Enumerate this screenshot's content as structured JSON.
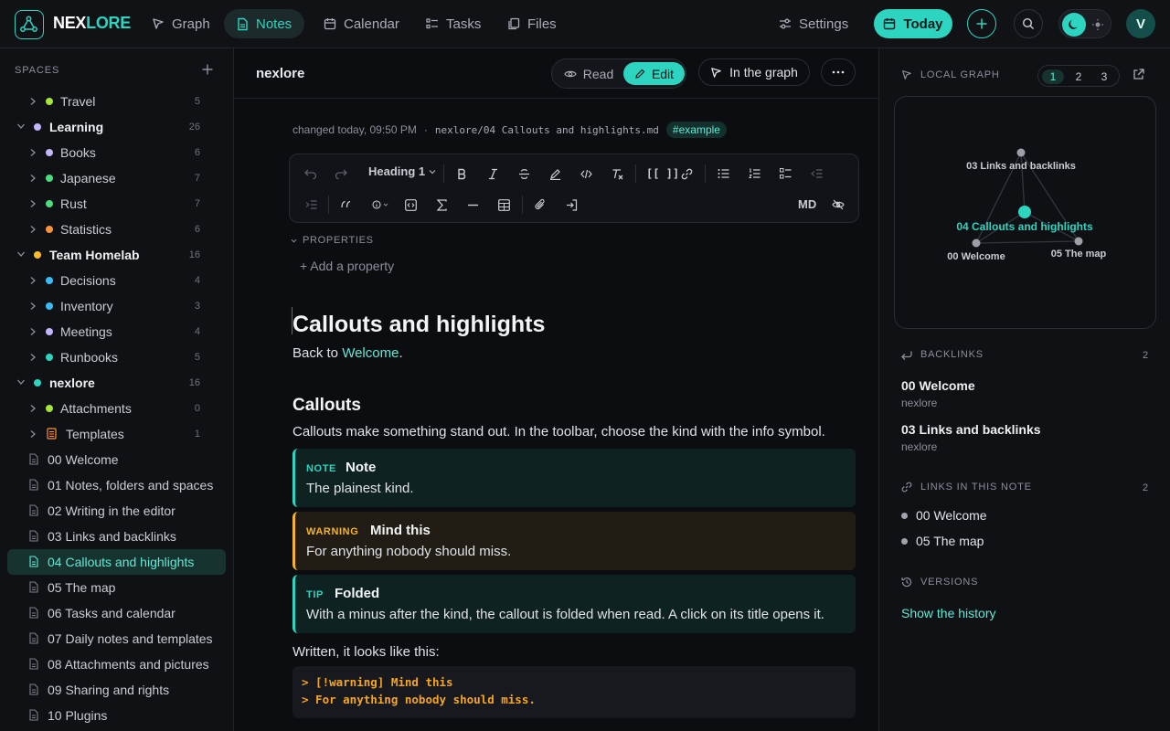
{
  "brand": {
    "part1": "NEX",
    "part2": "LORE"
  },
  "nav": {
    "graph": "Graph",
    "notes": "Notes",
    "calendar": "Calendar",
    "tasks": "Tasks",
    "files": "Files"
  },
  "topbar": {
    "settings": "Settings",
    "today": "Today",
    "avatar": "V"
  },
  "sidebar": {
    "title": "SPACES",
    "rows": [
      {
        "label": "Travel",
        "count": "5",
        "dot": "#a3e635"
      },
      {
        "label": "Learning",
        "count": "26",
        "dot": "#c4b5fd"
      },
      {
        "label": "Books",
        "count": "6",
        "dot": "#c4b5fd"
      },
      {
        "label": "Japanese",
        "count": "7",
        "dot": "#4ade80"
      },
      {
        "label": "Rust",
        "count": "7",
        "dot": "#4ade80"
      },
      {
        "label": "Statistics",
        "count": "6",
        "dot": "#fb923c"
      },
      {
        "label": "Team Homelab",
        "count": "16",
        "dot": "#fbbf24"
      },
      {
        "label": "Decisions",
        "count": "4",
        "dot": "#38bdf8"
      },
      {
        "label": "Inventory",
        "count": "3",
        "dot": "#38bdf8"
      },
      {
        "label": "Meetings",
        "count": "4",
        "dot": "#c4b5fd"
      },
      {
        "label": "Runbooks",
        "count": "5",
        "dot": "#2dd4bf"
      },
      {
        "label": "nexlore",
        "count": "16",
        "dot": "#2dd4bf"
      },
      {
        "label": "Attachments",
        "count": "0",
        "dot": "#a3e635"
      },
      {
        "label": "Templates",
        "count": "1"
      },
      {
        "label": "00 Welcome"
      },
      {
        "label": "01 Notes, folders and spaces"
      },
      {
        "label": "02 Writing in the editor"
      },
      {
        "label": "03 Links and backlinks"
      },
      {
        "label": "04 Callouts and highlights"
      },
      {
        "label": "05 The map"
      },
      {
        "label": "06 Tasks and calendar"
      },
      {
        "label": "07 Daily notes and templates"
      },
      {
        "label": "08 Attachments and pictures"
      },
      {
        "label": "09 Sharing and rights"
      },
      {
        "label": "10 Plugins"
      }
    ]
  },
  "editor": {
    "breadcrumb": "nexlore",
    "read": "Read",
    "edit": "Edit",
    "in_graph": "In the graph",
    "changed": "changed today, 09:50 PM",
    "sep": "·",
    "path": "nexlore/04 Callouts and highlights.md",
    "tag": "#example",
    "heading_select": "Heading 1",
    "link_btn": "[[ ]]",
    "md_btn": "MD",
    "properties": "PROPERTIES",
    "add_property": "+ Add a property"
  },
  "doc": {
    "h1": "Callouts and highlights",
    "back_prefix": "Back to ",
    "back_link": "Welcome",
    "back_suffix": ".",
    "h2": "Callouts",
    "intro": "Callouts make something stand out. In the toolbar, choose the kind with the info symbol.",
    "callouts": [
      {
        "kind": "NOTE",
        "title": "Note",
        "body": "The plainest kind."
      },
      {
        "kind": "WARNING",
        "title": "Mind this",
        "body": "For anything nobody should miss."
      },
      {
        "kind": "TIP",
        "title": "Folded",
        "body": "With a minus after the kind, the callout is folded when read. A click on its title opens it."
      }
    ],
    "written": "Written, it looks like this:",
    "code": [
      "> [!warning] Mind this",
      "> For anything nobody should miss."
    ]
  },
  "right": {
    "local_graph": "LOCAL GRAPH",
    "depths": [
      "1",
      "2",
      "3"
    ],
    "graph_nodes": [
      "03 Links and backlinks",
      "04 Callouts and highlights",
      "00 Welcome",
      "05 The map"
    ],
    "backlinks": "BACKLINKS",
    "backlinks_count": "2",
    "backlink_items": [
      {
        "title": "00 Welcome",
        "space": "nexlore"
      },
      {
        "title": "03 Links and backlinks",
        "space": "nexlore"
      }
    ],
    "links_head": "LINKS IN THIS NOTE",
    "links_count": "2",
    "links": [
      "00 Welcome",
      "05 The map"
    ],
    "versions": "VERSIONS",
    "history": "Show the history"
  },
  "colors": {
    "accent": "#2dd4bf",
    "warning": "#f5b32a"
  }
}
